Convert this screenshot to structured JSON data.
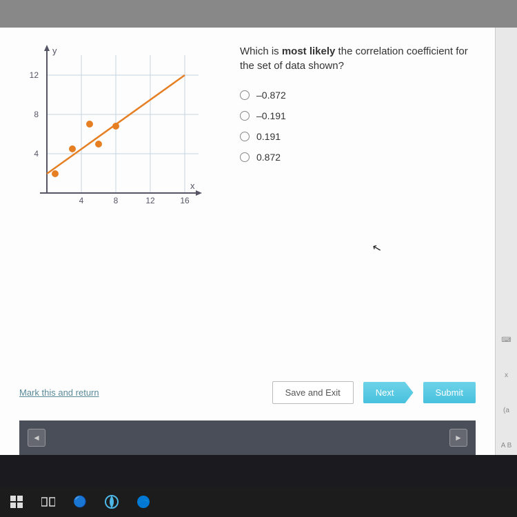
{
  "question": {
    "prompt_html": "Which is <b>most likely</b> the correlation coefficient for the set of data shown?",
    "options": [
      "–0.872",
      "–0.191",
      "0.191",
      "0.872"
    ]
  },
  "buttons": {
    "mark_return": "Mark this and return",
    "save_exit": "Save and Exit",
    "next": "Next",
    "submit": "Submit"
  },
  "side_labels": {
    "a": "(a",
    "ab": "A B"
  },
  "chart_data": {
    "type": "scatter",
    "title": "",
    "xlabel": "x",
    "ylabel": "y",
    "xlim": [
      0,
      16
    ],
    "ylim": [
      0,
      14
    ],
    "xticks": [
      4,
      8,
      12,
      16
    ],
    "yticks": [
      4,
      8,
      12
    ],
    "points": [
      {
        "x": 1,
        "y": 2
      },
      {
        "x": 3,
        "y": 4.5
      },
      {
        "x": 5,
        "y": 7
      },
      {
        "x": 6,
        "y": 5
      },
      {
        "x": 8,
        "y": 6.8
      }
    ],
    "trendline": {
      "x1": 0,
      "y1": 2,
      "x2": 16,
      "y2": 12
    },
    "colors": {
      "points": "#e67e22",
      "line": "#e67e22",
      "grid": "#c5d4e0",
      "axis": "#556"
    }
  }
}
